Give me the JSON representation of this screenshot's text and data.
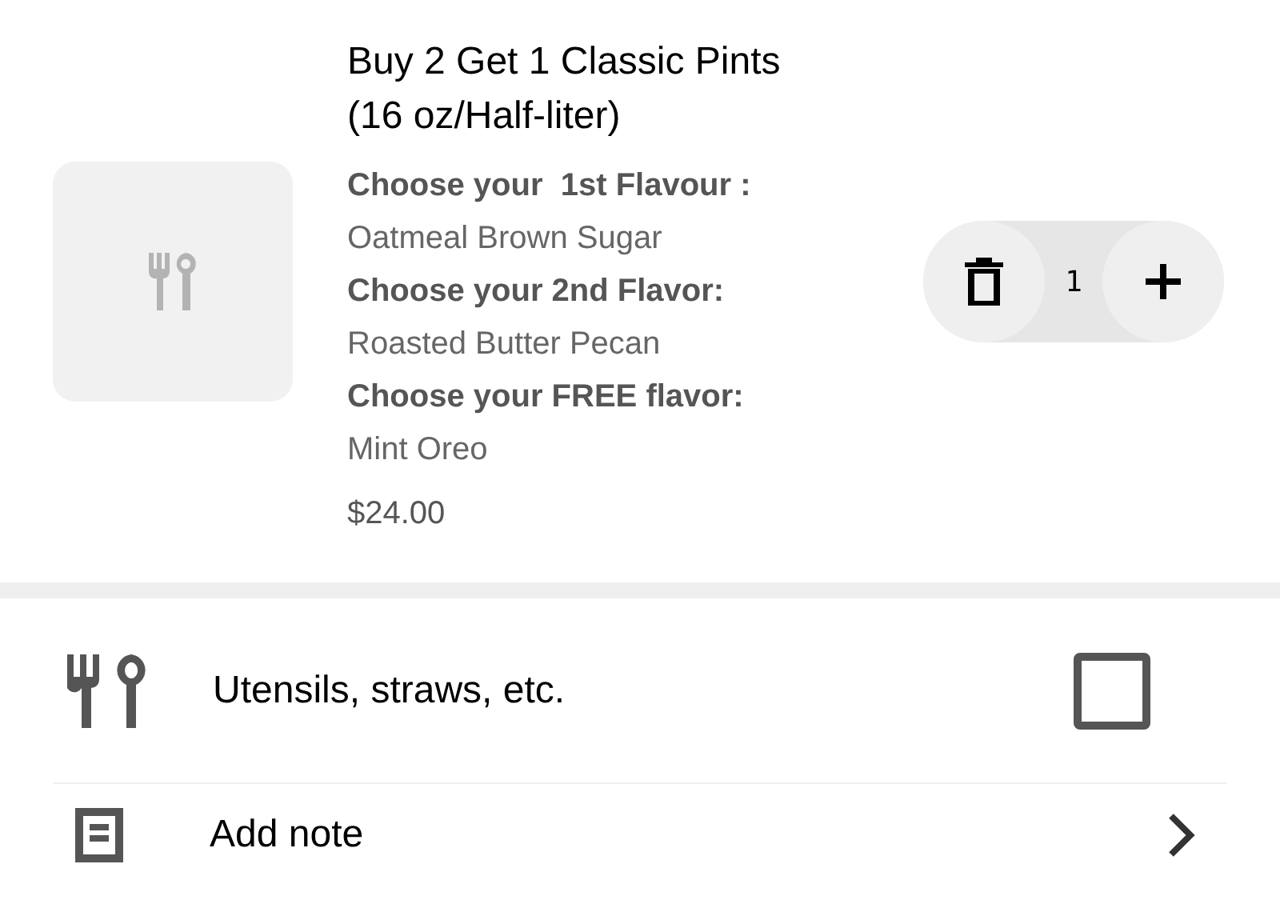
{
  "item": {
    "title": "Buy 2 Get 1 Classic Pints (16 oz/Half-liter)",
    "options": [
      {
        "label": "Choose your  1st Flavour :",
        "value": "Oatmeal Brown Sugar"
      },
      {
        "label": "Choose your 2nd Flavor:",
        "value": "Roasted Butter Pecan"
      },
      {
        "label": "Choose your FREE flavor:",
        "value": "Mint Oreo"
      }
    ],
    "price": "$24.00",
    "quantity": "1"
  },
  "extras": [
    {
      "kind": "checkbox",
      "label": "Utensils, straws, etc.",
      "checked": false
    },
    {
      "kind": "link",
      "label": "Add note"
    }
  ]
}
